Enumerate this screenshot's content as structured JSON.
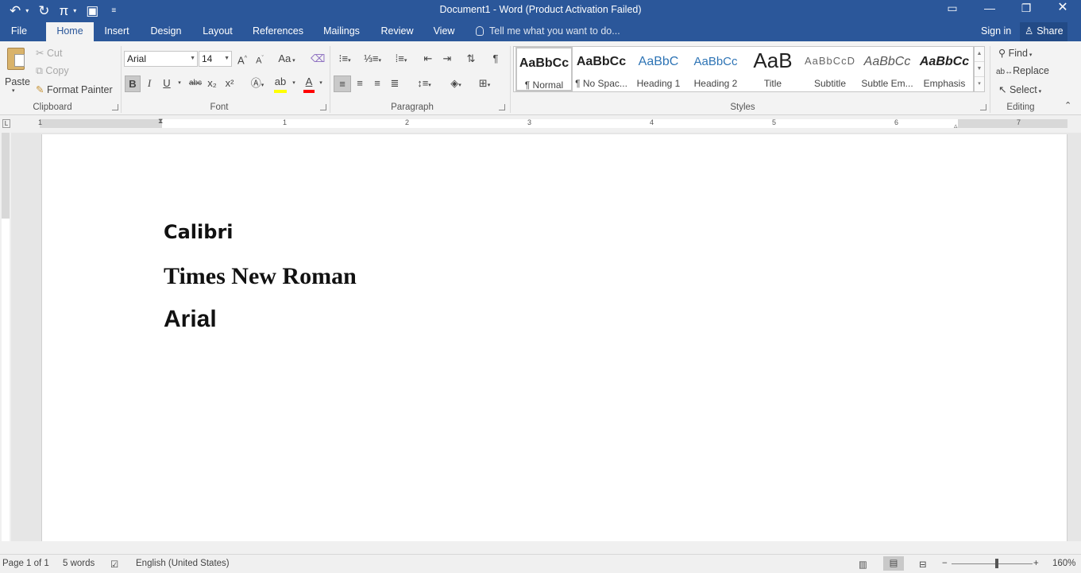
{
  "title_bar": {
    "title": "Document1 - Word (Product Activation Failed)",
    "undo_icon": "undo-icon",
    "redo_icon": "redo-icon",
    "pi_icon": "pi-equation-icon",
    "save_icon": "save-icon"
  },
  "tabs": [
    "File",
    "Home",
    "Insert",
    "Design",
    "Layout",
    "References",
    "Mailings",
    "Review",
    "View"
  ],
  "active_tab": "Home",
  "tell_me": "Tell me what you want to do...",
  "account": {
    "sign_in": "Sign in",
    "share": "Share"
  },
  "clipboard": {
    "paste": "Paste",
    "cut": "Cut",
    "copy": "Copy",
    "format_painter": "Format Painter",
    "label": "Clipboard"
  },
  "font": {
    "name": "Arial",
    "size": "14",
    "label": "Font",
    "change_case": "Aa",
    "bold": "B",
    "italic": "I",
    "underline": "U",
    "strikethrough": "abc",
    "subscript": "x₂",
    "superscript": "x²"
  },
  "paragraph": {
    "label": "Paragraph"
  },
  "styles": {
    "label": "Styles",
    "items": [
      {
        "preview": "AaBbCc",
        "name": "¶ Normal"
      },
      {
        "preview": "AaBbCc",
        "name": "¶ No Spac..."
      },
      {
        "preview": "AaBbC",
        "name": "Heading 1"
      },
      {
        "preview": "AaBbCc",
        "name": "Heading 2"
      },
      {
        "preview": "AaB",
        "name": "Title"
      },
      {
        "preview": "AaBbCcD",
        "name": "Subtitle"
      },
      {
        "preview": "AaBbCc",
        "name": "Subtle Em..."
      },
      {
        "preview": "AaBbCc",
        "name": "Emphasis"
      }
    ]
  },
  "editing": {
    "find": "Find",
    "replace": "Replace",
    "select": "Select",
    "label": "Editing"
  },
  "ruler": {
    "numbers": [
      "1",
      "1",
      "2",
      "3",
      "4",
      "5",
      "6",
      "7"
    ]
  },
  "document": {
    "lines": [
      "Calibri",
      "Times New Roman",
      "Arial"
    ]
  },
  "status": {
    "page": "Page 1 of 1",
    "words": "5 words",
    "language": "English (United States)",
    "zoom": "160%"
  },
  "colors": {
    "brand": "#2b579a",
    "highlight": "#ffff00",
    "font_color": "#ff0000"
  }
}
